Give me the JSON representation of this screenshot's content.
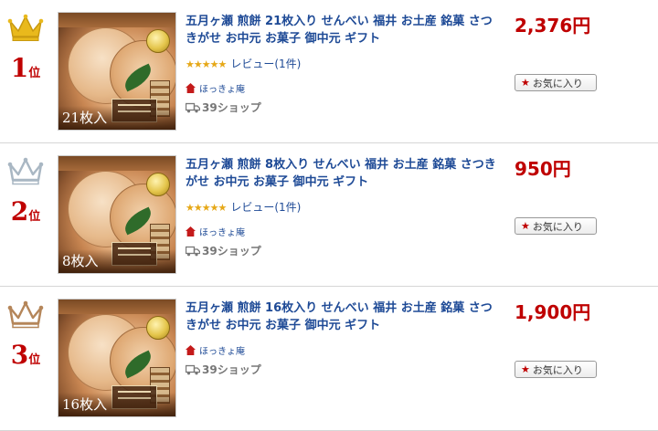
{
  "items": [
    {
      "rank": "1",
      "rank_suffix": "位",
      "crown_color": "#e9b91c",
      "count_label": "21枚入",
      "title": "五月ヶ瀬 煎餅 21枚入り せんべい 福井 お土産 銘菓 さつきがせ お中元 お菓子 御中元 ギフト",
      "stars": "★★★★★",
      "review": "レビュー(1件)",
      "shop": "ほっきょ庵",
      "shipping": "39ショップ",
      "price": "2,376円",
      "favorite": "お気に入り"
    },
    {
      "rank": "2",
      "rank_suffix": "位",
      "crown_color": "#a9b7c3",
      "count_label": "8枚入",
      "title": "五月ヶ瀬 煎餅 8枚入り せんべい 福井 お土産 銘菓 さつきがせ お中元 お菓子 御中元 ギフト",
      "stars": "★★★★★",
      "review": "レビュー(1件)",
      "shop": "ほっきょ庵",
      "shipping": "39ショップ",
      "price": "950円",
      "favorite": "お気に入り"
    },
    {
      "rank": "3",
      "rank_suffix": "位",
      "crown_color": "#b5865a",
      "count_label": "16枚入",
      "title": "五月ヶ瀬 煎餅 16枚入り せんべい 福井 お土産 銘菓 さつきがせ お中元 お菓子 御中元 ギフト",
      "shop": "ほっきょ庵",
      "shipping": "39ショップ",
      "price": "1,900円",
      "favorite": "お気に入り"
    }
  ],
  "colors": {
    "accent_red": "#bf0000",
    "link_blue": "#1e4a96",
    "star_yellow": "#e6a817"
  },
  "icons": {
    "crown": "crown-icon",
    "shop": "shop-house-icon",
    "truck": "truck-icon",
    "favorite": "star-icon"
  }
}
